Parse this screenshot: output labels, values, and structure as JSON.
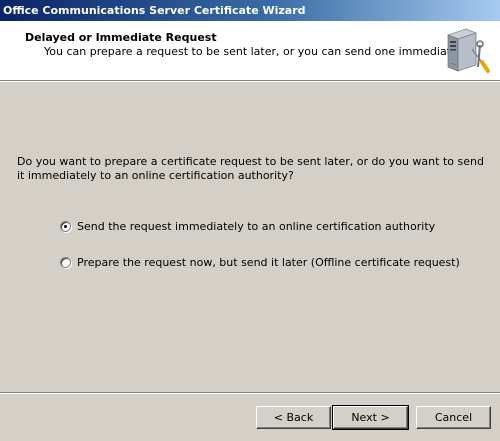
{
  "window": {
    "title": "Office Communications Server Certificate Wizard"
  },
  "header": {
    "title": "Delayed or Immediate Request",
    "subtitle": "You can prepare a request to be sent later, or you can send one immediately.",
    "icon": "server-tools-icon"
  },
  "main": {
    "question": "Do you want to prepare a certificate request to be sent later, or do you want to send it immediately to an online certification authority?",
    "options": [
      {
        "label": "Send the request immediately to an online certification authority",
        "selected": true
      },
      {
        "label": "Prepare the request now, but send it later (Offline certificate request)",
        "selected": false
      }
    ]
  },
  "footer": {
    "back_label": "< Back",
    "next_label": "Next >",
    "cancel_label": "Cancel"
  }
}
